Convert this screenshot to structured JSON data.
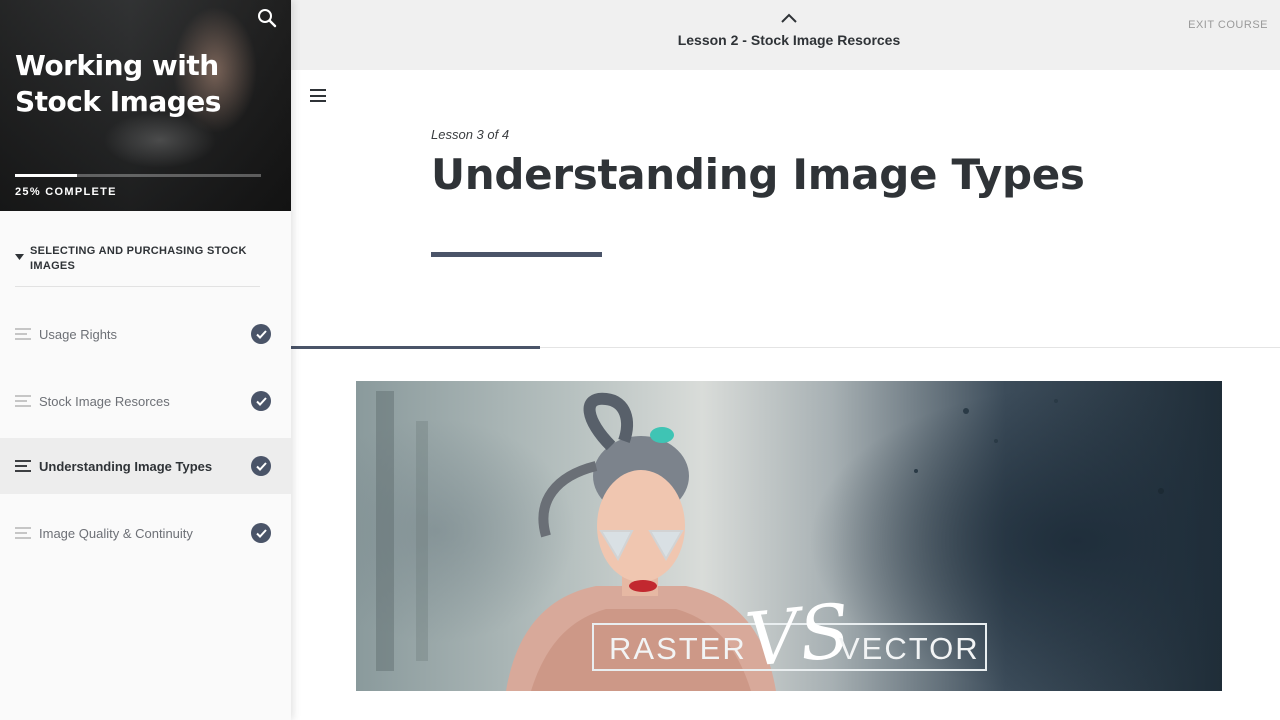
{
  "course": {
    "title": "Working with Stock Images",
    "progress_percent": 25,
    "progress_label": "25% COMPLETE"
  },
  "sidebar": {
    "section_title": "SELECTING AND PURCHASING STOCK IMAGES",
    "lessons": [
      {
        "label": "Usage Rights",
        "completed": true,
        "active": false
      },
      {
        "label": "Stock Image Resorces",
        "completed": true,
        "active": false
      },
      {
        "label": "Understanding Image Types",
        "completed": true,
        "active": true
      },
      {
        "label": "Image Quality & Continuity",
        "completed": true,
        "active": false
      }
    ]
  },
  "topbar": {
    "lesson_title": "Lesson 2 - Stock Image Resorces",
    "exit_label": "EXIT COURSE"
  },
  "main": {
    "lesson_counter": "Lesson 3 of 4",
    "title": "Understanding Image Types"
  },
  "banner": {
    "left_text": "RASTER",
    "middle_text": "VS",
    "right_text": "VECTOR"
  },
  "colors": {
    "accent": "#4a5468",
    "topbar_bg": "#f0f0f0",
    "sidebar_bg": "#fafafa",
    "text_dark": "#2f3337"
  },
  "icons": {
    "search": "search-icon",
    "menu": "hamburger-menu-icon",
    "collapse": "chevron-up-icon",
    "section_toggle": "caret-down-icon",
    "lesson": "lesson-lines-icon",
    "complete": "check-circle-icon"
  }
}
